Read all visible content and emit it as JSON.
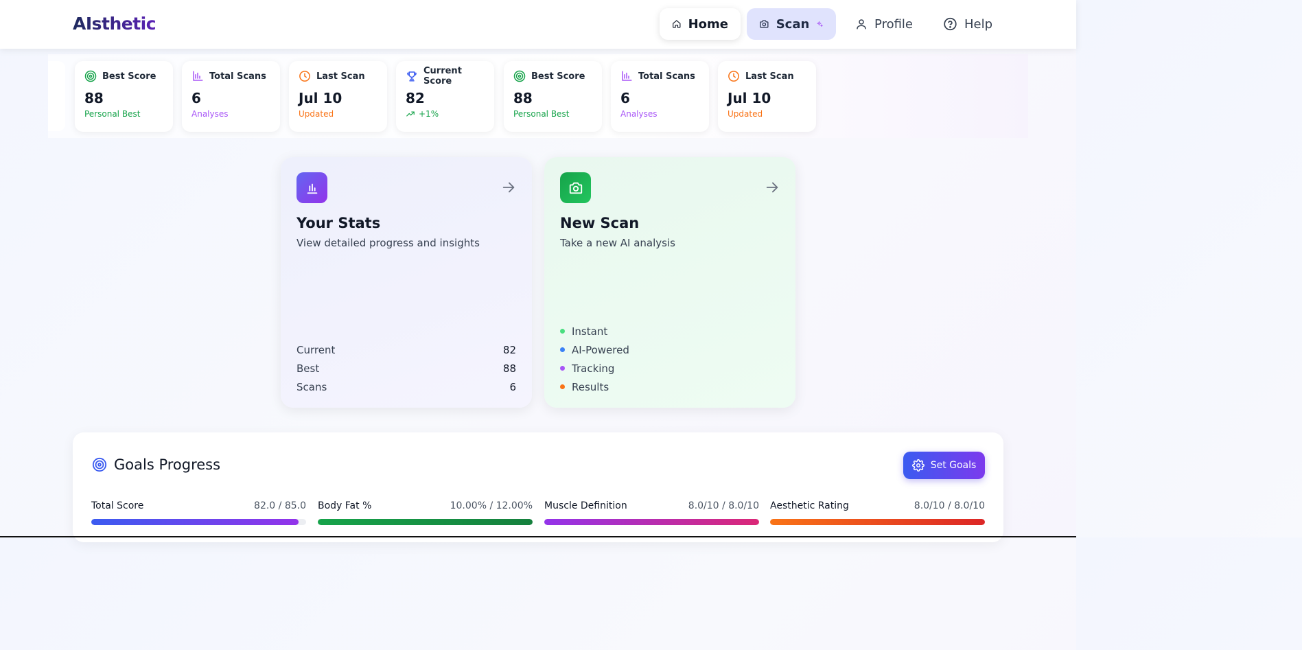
{
  "brand": "AIsthetic",
  "nav": {
    "home": "Home",
    "scan": "Scan",
    "profile": "Profile",
    "help": "Help"
  },
  "stats_strip": [
    {
      "title": "Best Score",
      "value": "88",
      "sub": "Personal Best",
      "icon": "target-icon",
      "color": "#16a34a"
    },
    {
      "title": "Total Scans",
      "value": "6",
      "sub": "Analyses",
      "icon": "bar-chart-icon",
      "color": "#a855f7"
    },
    {
      "title": "Last Scan",
      "value": "Jul 10",
      "sub": "Updated",
      "icon": "clock-icon",
      "color": "#f97316"
    },
    {
      "title": "Current Score",
      "value": "82",
      "sub": "+1%",
      "icon": "trophy-icon",
      "color": "#16a34a"
    },
    {
      "title": "Best Score",
      "value": "88",
      "sub": "Personal Best",
      "icon": "target-icon",
      "color": "#16a34a"
    },
    {
      "title": "Total Scans",
      "value": "6",
      "sub": "Analyses",
      "icon": "bar-chart-icon",
      "color": "#a855f7"
    },
    {
      "title": "Last Scan",
      "value": "Jul 10",
      "sub": "Updated",
      "icon": "clock-icon",
      "color": "#f97316"
    }
  ],
  "your_stats": {
    "title": "Your Stats",
    "desc": "View detailed progress and insights",
    "rows": [
      {
        "label": "Current",
        "value": "82"
      },
      {
        "label": "Best",
        "value": "88"
      },
      {
        "label": "Scans",
        "value": "6"
      }
    ]
  },
  "new_scan": {
    "title": "New Scan",
    "desc": "Take a new AI analysis",
    "features": [
      {
        "label": "Instant",
        "color": "#4ade80"
      },
      {
        "label": "AI-Powered",
        "color": "#3b82f6"
      },
      {
        "label": "Tracking",
        "color": "#a855f7"
      },
      {
        "label": "Results",
        "color": "#f97316"
      }
    ]
  },
  "goals": {
    "title": "Goals Progress",
    "button": "Set Goals",
    "items": [
      {
        "name": "Total Score",
        "value": "82.0 / 85.0",
        "progress": 0.965
      },
      {
        "name": "Body Fat %",
        "value": "10.00% / 12.00%",
        "progress": 1.0
      },
      {
        "name": "Muscle Definition",
        "value": "8.0/10 / 8.0/10",
        "progress": 1.0
      },
      {
        "name": "Aesthetic Rating",
        "value": "8.0/10 / 8.0/10",
        "progress": 1.0
      }
    ]
  }
}
